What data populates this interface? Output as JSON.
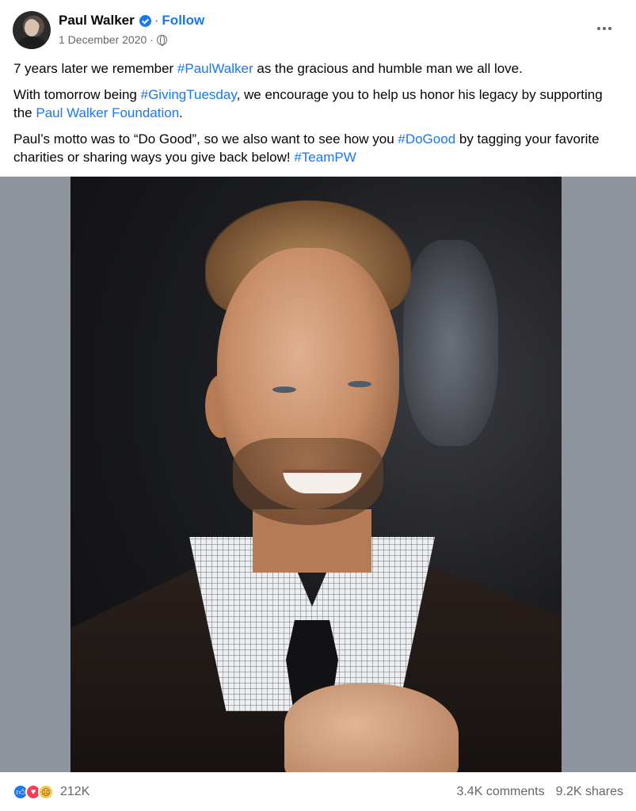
{
  "post": {
    "author": "Paul Walker",
    "separator": "·",
    "follow_label": "Follow",
    "date": "1 December 2020",
    "date_separator": "·",
    "paragraphs": {
      "p1": {
        "before": "7 years later we remember ",
        "tag": "#PaulWalker",
        "after": " as the gracious and humble man we all love."
      },
      "p2": {
        "before": "With tomorrow being ",
        "tag": "#GivingTuesday",
        "middle": ", we encourage you to help us honor his legacy by supporting the ",
        "link": "Paul Walker Foundation",
        "after": "."
      },
      "p3": {
        "before": "Paul’s motto was to “Do Good”, so we also want to see how you ",
        "tag": "#DoGood",
        "middle": " by tagging your favorite charities or sharing ways you give back below! ",
        "tag2": "#TeamPW"
      }
    },
    "photo_icon": "portrait-photo",
    "footer": {
      "reaction_count": "212K",
      "comments": "3.4K comments",
      "shares": "9.2K shares"
    }
  },
  "icons": {
    "verified": "verified-badge-icon",
    "globe": "globe-icon",
    "more": "more-options-icon",
    "like": "like-reaction-icon",
    "love": "love-reaction-icon",
    "sad": "sad-reaction-icon"
  },
  "colors": {
    "accent": "#1877f2",
    "secondary_text": "#65676b",
    "media_background": "#8d949e"
  }
}
